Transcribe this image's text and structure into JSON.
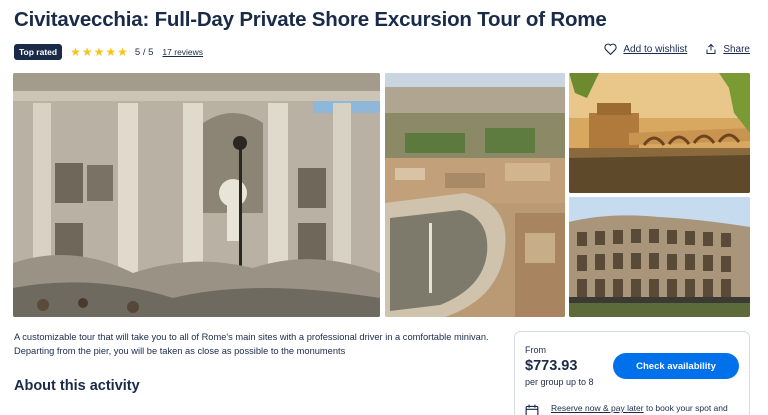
{
  "title": "Civitavecchia: Full-Day Private Shore Excursion Tour of Rome",
  "badge": "Top rated",
  "rating_value": 5,
  "rating_text": "5 / 5",
  "reviews_link": "17 reviews",
  "wishlist_label": "Add to wishlist",
  "share_label": "Share",
  "photos": [
    {
      "icon": "trevi-fountain"
    },
    {
      "icon": "st-peters-square"
    },
    {
      "icon": "castel-sant-angelo"
    },
    {
      "icon": "colosseum"
    }
  ],
  "description": "A customizable tour that will take you to all of Rome's main sites with a professional driver in a comfortable minivan. Departing from the pier, you will be taken as close as possible to the monuments",
  "about_heading": "About this activity",
  "booking": {
    "from_label": "From",
    "price": "$773.93",
    "per_label": "per group up to 8",
    "button_label": "Check availability",
    "reserve_link": "Reserve now & pay later",
    "reserve_text": " to book your spot and"
  },
  "colors": {
    "brand_blue": "#0071eb",
    "navy": "#1a2b49",
    "star": "#f5c518"
  }
}
